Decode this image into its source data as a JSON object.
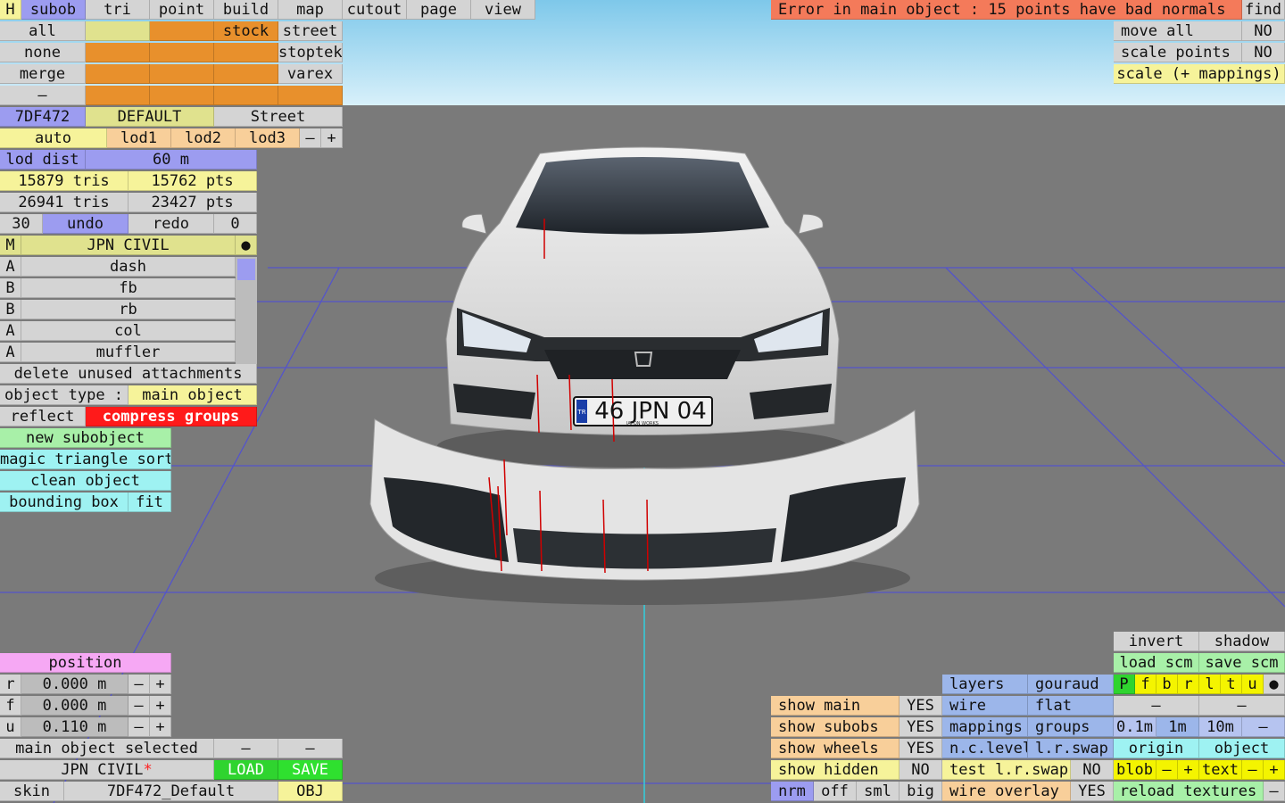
{
  "top_menu": {
    "h": "H",
    "subob": "subob",
    "tri": "tri",
    "point": "point",
    "build": "build",
    "map": "map",
    "cutout": "cutout",
    "page": "page",
    "view": "view"
  },
  "error_message": "Error in main object : 15 points have bad normals",
  "find_label": "find",
  "transform": {
    "move_all": "move all",
    "move_all_value": "NO",
    "scale_points": "scale points",
    "scale_points_value": "NO",
    "scale_mappings": "scale (+ mappings)"
  },
  "selection": {
    "all": "all",
    "none": "none",
    "merge": "merge",
    "dash": "–"
  },
  "material_tags": {
    "stock": "stock",
    "street": "street",
    "stoptek": "stoptek",
    "varex": "varex"
  },
  "color_code": "7DF472",
  "paint_name": "DEFAULT",
  "paint_type": "Street",
  "lod": {
    "auto": "auto",
    "lod1": "lod1",
    "lod2": "lod2",
    "lod3": "lod3",
    "minus": "–",
    "plus": "+",
    "dist_label": "lod dist",
    "dist_value": "60 m"
  },
  "stats": {
    "tris1": "15879 tris",
    "pts1": "15762 pts",
    "tris2": "26941 tris",
    "pts2": "23427 pts"
  },
  "undo_bar": {
    "count": "30",
    "undo": "undo",
    "redo": "redo",
    "redo_count": "0"
  },
  "object_header": {
    "letter": "M",
    "name": "JPN CIVIL",
    "dot": "●"
  },
  "subobjects": [
    {
      "tag": "A",
      "name": "dash"
    },
    {
      "tag": "B",
      "name": "fb"
    },
    {
      "tag": "B",
      "name": "rb"
    },
    {
      "tag": "A",
      "name": "col"
    },
    {
      "tag": "A",
      "name": "muffler"
    }
  ],
  "delete_unused": "delete unused attachments",
  "object_type_label": "object type :",
  "object_type_value": "main object",
  "reflect": "reflect",
  "compress_groups": "compress groups",
  "actions": {
    "new_subobject": "new subobject",
    "magic_sort": "magic triangle sort",
    "clean_object": "clean object",
    "bounding_box": "bounding box",
    "fit": "fit"
  },
  "position": {
    "title": "position",
    "rows": [
      {
        "axis": "r",
        "value": "0.000 m"
      },
      {
        "axis": "f",
        "value": "0.000 m"
      },
      {
        "axis": "u",
        "value": "0.110 m"
      }
    ],
    "minus": "–",
    "plus": "+"
  },
  "status": {
    "selected": "main object selected",
    "dash": "–",
    "name": "JPN CIVIL",
    "modified_mark": "*",
    "load": "LOAD",
    "save": "SAVE",
    "skin_label": "skin",
    "skin_value": "7DF472_Default",
    "obj": "OBJ"
  },
  "display": {
    "show_main": "show main",
    "show_main_val": "YES",
    "show_subobs": "show subobs",
    "show_subobs_val": "YES",
    "show_wheels": "show wheels",
    "show_wheels_val": "YES",
    "show_hidden": "show hidden",
    "show_hidden_val": "NO",
    "nrm": "nrm",
    "off": "off",
    "sml": "sml",
    "big": "big"
  },
  "render": {
    "layers": "layers",
    "gouraud": "gouraud",
    "wire": "wire",
    "flat": "flat",
    "mappings": "mappings",
    "groups": "groups",
    "nc_level": "n.c.level",
    "lr_swap": "l.r.swap",
    "test_lr_swap": "test l.r.swap",
    "test_lr_swap_val": "NO",
    "wire_overlay": "wire overlay",
    "wire_overlay_val": "YES"
  },
  "right_panel": {
    "invert": "invert",
    "shadow": "shadow",
    "load_scm": "load scm",
    "save_scm": "save scm",
    "letters": [
      "P",
      "f",
      "b",
      "r",
      "l",
      "t",
      "u"
    ],
    "dot": "●",
    "dash": "–",
    "steps": [
      "0.1m",
      "1m",
      "10m"
    ],
    "origin": "origin",
    "object": "object",
    "blob": "blob",
    "text": "text",
    "minus": "–",
    "plus": "+",
    "reload_textures": "reload textures"
  },
  "plate": {
    "text": "46 JPN 04",
    "country": "TR",
    "small": "JAPON WORKS"
  }
}
